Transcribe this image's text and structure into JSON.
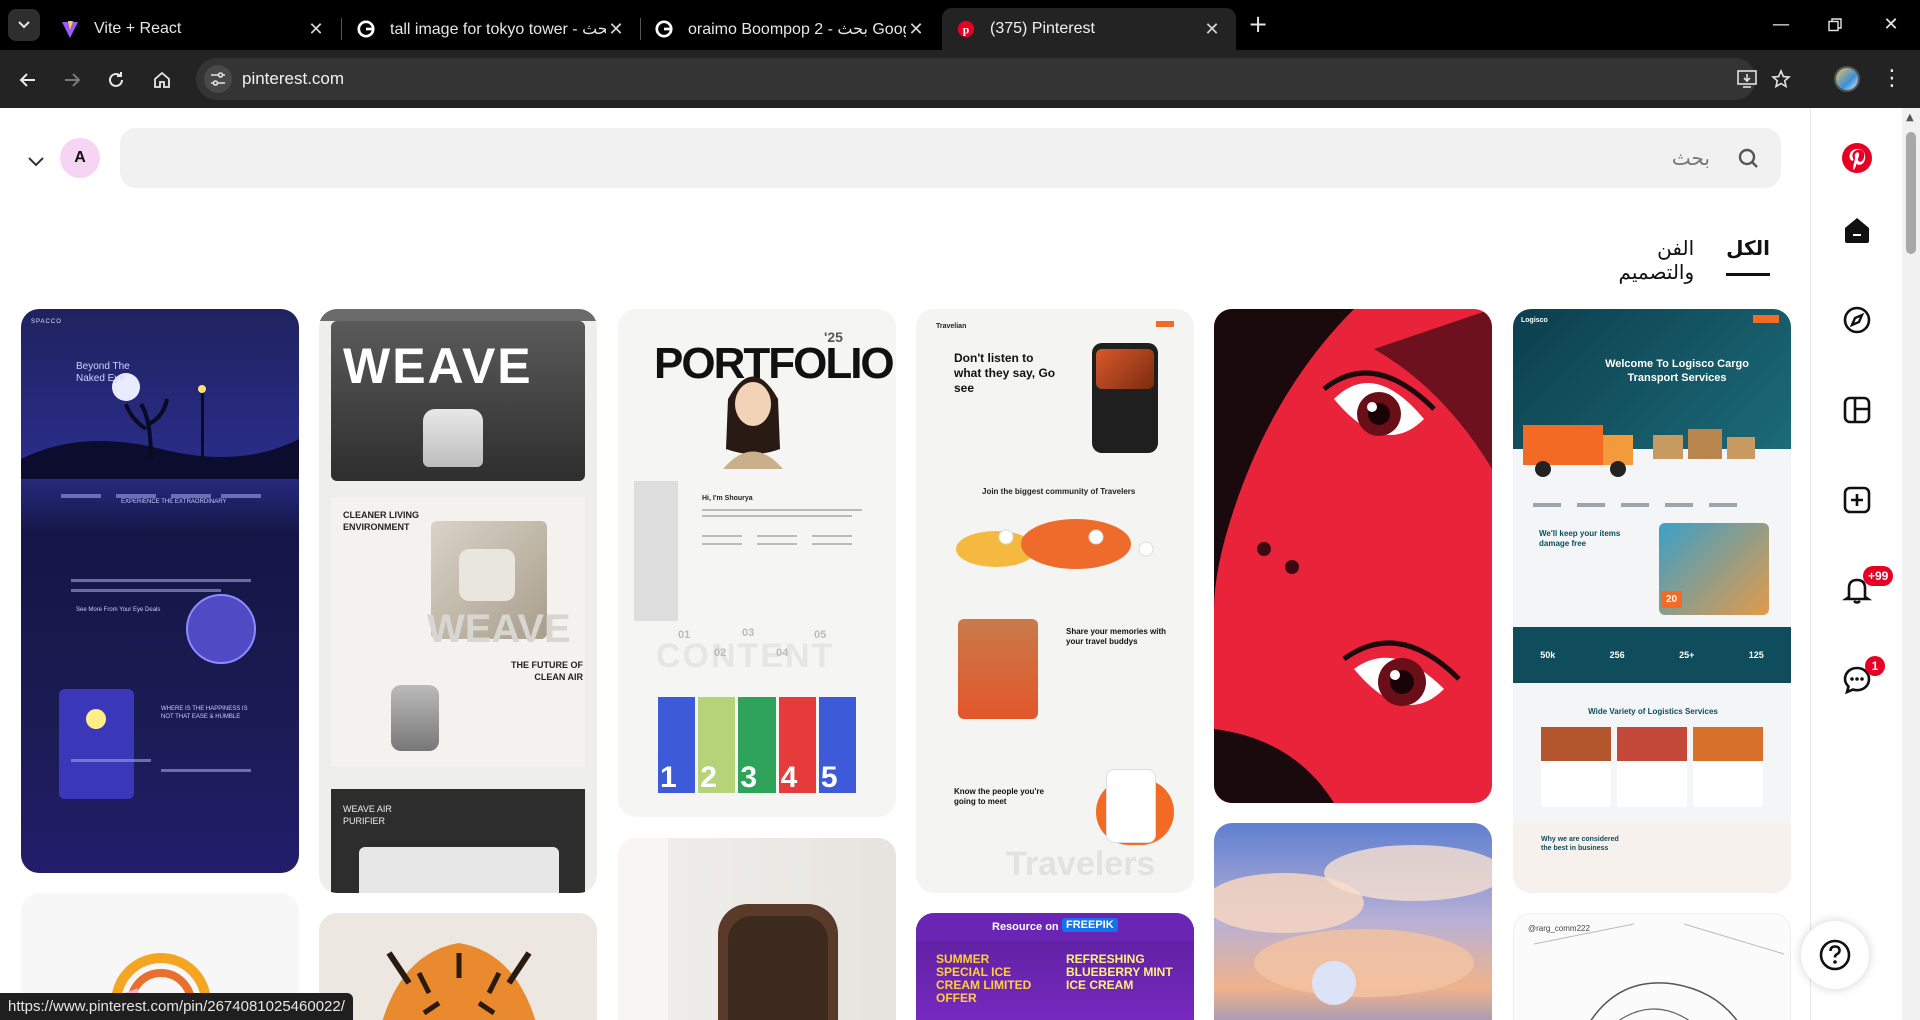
{
  "browser": {
    "tabs": [
      {
        "title": "Vite + React",
        "favicon": "vite-logo",
        "active": false
      },
      {
        "title": "tall image for tokyo tower - بحث",
        "favicon": "google-logo",
        "active": false
      },
      {
        "title": "oraimo Boompop 2 - بحث Goog",
        "favicon": "google-logo",
        "active": false
      },
      {
        "title": "(375) Pinterest",
        "favicon": "pinterest-logo",
        "active": true
      }
    ],
    "url": "pinterest.com",
    "status_url": "https://www.pinterest.com/pin/2674081025460022/"
  },
  "header": {
    "avatar_letter": "A",
    "search_placeholder": "بحث"
  },
  "filters": [
    {
      "label": "الكل",
      "active": true
    },
    {
      "label": "الفن والتصميم",
      "active": false
    }
  ],
  "rail": {
    "notifications_badge": "+99",
    "messages_badge": "1"
  },
  "pins": {
    "spacco": {
      "brand": "SPACCO",
      "headline": "Beyond The Naked Eye",
      "section": "EXPERIENCE THE EXTRAORDINARY",
      "line2": "See More From Your Eye Deals",
      "line3": "WHERE IS THE HAPPINESS IS NOT THAT EASE & HUMBLE"
    },
    "weave": {
      "title": "WEAVE",
      "section1": "CLEANER LIVING ENVIRONMENT",
      "section2": "THE FUTURE OF CLEAN AIR",
      "section3": "WEAVE AIR PURIFIER",
      "watermark": "WEAVE"
    },
    "portfolio": {
      "title": "PORTFOLIO",
      "year": "'25",
      "greeting": "Hi, I'm Shourya",
      "content_word": "CONTENT",
      "numbers": [
        "01",
        "02",
        "03",
        "04",
        "05"
      ],
      "digits": [
        "1",
        "2",
        "3",
        "4",
        "5"
      ]
    },
    "travelers": {
      "brand": "Travelian",
      "headline": "Don't listen to what they say, Go see",
      "community": "Join the biggest community of Travelers",
      "memories": "Share your memories with your travel buddys",
      "meet": "Know the people you're going to meet",
      "watermark": "Travelers"
    },
    "logisco": {
      "brand": "Logisco",
      "headline": "Welcome To Logisco Cargo Transport Services",
      "section1": "We'll keep your items damage free",
      "stats": [
        "50k",
        "256",
        "25+",
        "125"
      ],
      "section2": "Wide Variety of Logistics Services",
      "section3": "Why we are considered the best in business",
      "badge": "20"
    },
    "freepik": {
      "label": "Resource on",
      "brand": "FREEPIK",
      "left_promo": "SUMMER SPECIAL ICE CREAM LIMITED OFFER",
      "right_promo": "REFRESHING BLUEBERRY MINT ICE CREAM"
    },
    "sketch": {
      "caption": "@rarg_comm222"
    }
  },
  "colors": {
    "pinterest_red": "#e60023",
    "space_navy": "#1e1e5a",
    "anime_red": "#e8243a",
    "logisco_teal": "#0f4d5c",
    "logisco_orange": "#f26a24"
  }
}
